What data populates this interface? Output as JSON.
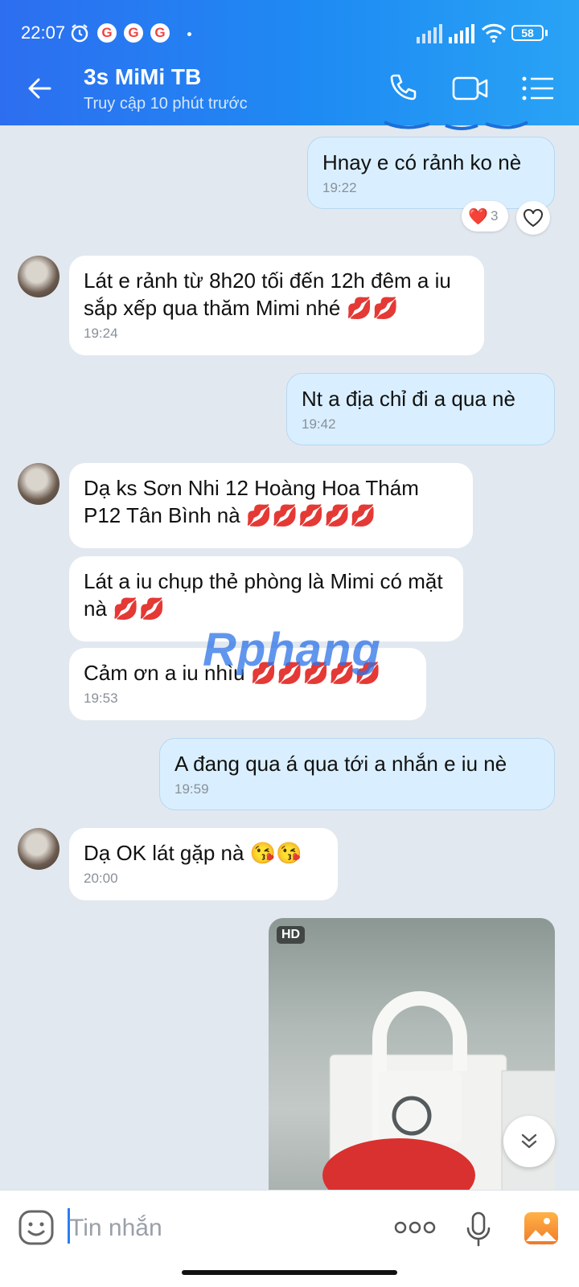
{
  "status_bar": {
    "time": "22:07",
    "battery": "58"
  },
  "header": {
    "title": "3s MiMi TB",
    "subtitle": "Truy cập 10 phút trước"
  },
  "messages": [
    {
      "text": "Hnay e có rảnh ko nè",
      "time": "19:22"
    },
    {
      "text": "Lát e rảnh từ 8h20 tối đến 12h đêm a iu sắp xếp qua thăm Mimi nhé 💋💋",
      "time": "19:24"
    },
    {
      "text": "Nt a địa chỉ đi a qua nè",
      "time": "19:42"
    },
    {
      "text": "Dạ ks Sơn Nhi 12 Hoàng Hoa Thám P12 Tân Bình nà 💋💋💋💋💋"
    },
    {
      "text": "Lát a iu chụp thẻ phòng là Mimi có mặt nà 💋💋"
    },
    {
      "text": "Cảm ơn a iu nhìu 💋💋💋💋💋",
      "time": "19:53"
    },
    {
      "text": "A đang qua á qua tới a nhắn e iu nè",
      "time": "19:59"
    },
    {
      "text": "Dạ OK lát gặp nà 😘😘",
      "time": "20:00"
    }
  ],
  "reaction": {
    "emoji": "❤️",
    "count": "3"
  },
  "photo": {
    "badge": "HD"
  },
  "watermark": "Rphang",
  "input": {
    "placeholder": "Tin nhắn"
  },
  "colors": {
    "header_start": "#2d6ef0",
    "header_end": "#29a3f5",
    "mine_bubble": "#d9efff",
    "chat_bg": "#e2e8ef",
    "accent": "#2a7ef5"
  }
}
